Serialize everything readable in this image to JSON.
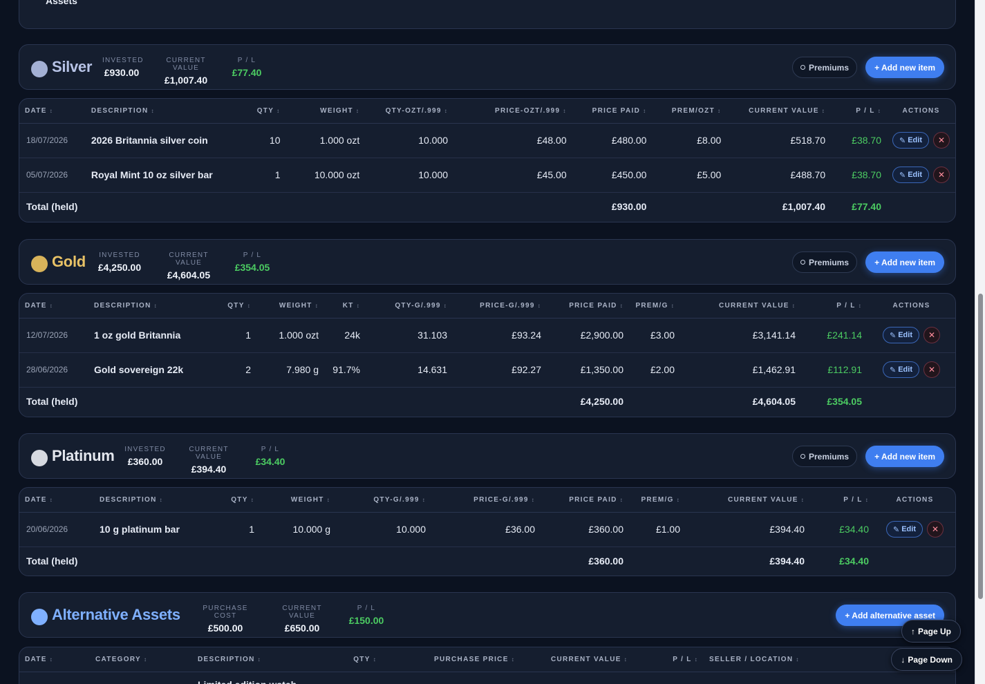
{
  "top_section": {
    "label": "Assets"
  },
  "common": {
    "premiums_label": "Premiums",
    "add_label": "+ Add new item",
    "edit_label": "Edit",
    "delete_label": "✕",
    "total_label": "Total (held)"
  },
  "silver": {
    "title": "Silver",
    "dot_color": "#a3b0d4",
    "title_color": "#b7c3e6",
    "stats": [
      {
        "k": "INVESTED",
        "v": "£930.00"
      },
      {
        "k": "CURRENT VALUE",
        "v": "£1,007.40"
      },
      {
        "k": "P / L",
        "v": "£77.40"
      }
    ],
    "columns": [
      "DATE",
      "DESCRIPTION",
      "QTY",
      "WEIGHT",
      "QTY-OZT/.999",
      "PRICE-OZT/.999",
      "PRICE PAID",
      "PREM/OZT",
      "CURRENT VALUE",
      "P / L",
      "ACTIONS"
    ],
    "rows": [
      [
        "18/07/2026",
        "2026 Britannia silver coin",
        "10",
        "1.000 ozt",
        "10.000",
        "£48.00",
        "£480.00",
        "£8.00",
        "£518.70",
        "£38.70"
      ],
      [
        "05/07/2026",
        "Royal Mint 10 oz silver bar",
        "1",
        "10.000 ozt",
        "10.000",
        "£45.00",
        "£450.00",
        "£5.00",
        "£488.70",
        "£38.70"
      ]
    ],
    "totals": {
      "paid": "£930.00",
      "value": "£1,007.40",
      "pl": "£77.40"
    }
  },
  "gold": {
    "title": "Gold",
    "dot_color": "#d8b35a",
    "title_color": "#e8c266",
    "stats": [
      {
        "k": "INVESTED",
        "v": "£4,250.00"
      },
      {
        "k": "CURRENT VALUE",
        "v": "£4,604.05"
      },
      {
        "k": "P / L",
        "v": "£354.05"
      }
    ],
    "columns": [
      "DATE",
      "DESCRIPTION",
      "QTY",
      "WEIGHT",
      "KT",
      "QTY-G/.999",
      "PRICE-G/.999",
      "PRICE PAID",
      "PREM/G",
      "CURRENT VALUE",
      "P / L",
      "ACTIONS"
    ],
    "rows": [
      [
        "12/07/2026",
        "1 oz gold Britannia",
        "1",
        "1.000 ozt",
        "24k",
        "31.103",
        "£93.24",
        "£2,900.00",
        "£3.00",
        "£3,141.14",
        "£241.14"
      ],
      [
        "28/06/2026",
        "Gold sovereign 22k",
        "2",
        "7.980 g",
        "91.7%",
        "14.631",
        "£92.27",
        "£1,350.00",
        "£2.00",
        "£1,462.91",
        "£112.91"
      ]
    ],
    "totals": {
      "paid": "£4,250.00",
      "value": "£4,604.05",
      "pl": "£354.05"
    }
  },
  "platinum": {
    "title": "Platinum",
    "dot_color": "#d6d9e0",
    "title_color": "#e4e7ee",
    "stats": [
      {
        "k": "INVESTED",
        "v": "£360.00"
      },
      {
        "k": "CURRENT VALUE",
        "v": "£394.40"
      },
      {
        "k": "P / L",
        "v": "£34.40"
      }
    ],
    "columns": [
      "DATE",
      "DESCRIPTION",
      "QTY",
      "WEIGHT",
      "QTY-G/.999",
      "PRICE-G/.999",
      "PRICE PAID",
      "PREM/G",
      "CURRENT VALUE",
      "P / L",
      "ACTIONS"
    ],
    "rows": [
      [
        "20/06/2026",
        "10 g platinum bar",
        "1",
        "10.000 g",
        "10.000",
        "£36.00",
        "£360.00",
        "£1.00",
        "£394.40",
        "£34.40"
      ]
    ],
    "totals": {
      "paid": "£360.00",
      "value": "£394.40",
      "pl": "£34.40"
    }
  },
  "alternative": {
    "title": "Alternative Assets",
    "dot_color": "#7fb0ff",
    "title_color": "#7fb0ff",
    "stats": [
      {
        "k": "PURCHASE COST",
        "v": "£500.00"
      },
      {
        "k": "CURRENT VALUE",
        "v": "£650.00"
      },
      {
        "k": "P / L",
        "v": "£150.00"
      }
    ],
    "add_label": "+ Add alternative asset",
    "columns": [
      "DATE",
      "CATEGORY",
      "DESCRIPTION",
      "QTY",
      "PURCHASE PRICE",
      "CURRENT VALUE",
      "P / L",
      "SELLER / LOCATION"
    ],
    "partial_row_desc": "Limited edition watch"
  },
  "floating": {
    "page_up": "Page Up",
    "page_down": "Page Down"
  }
}
